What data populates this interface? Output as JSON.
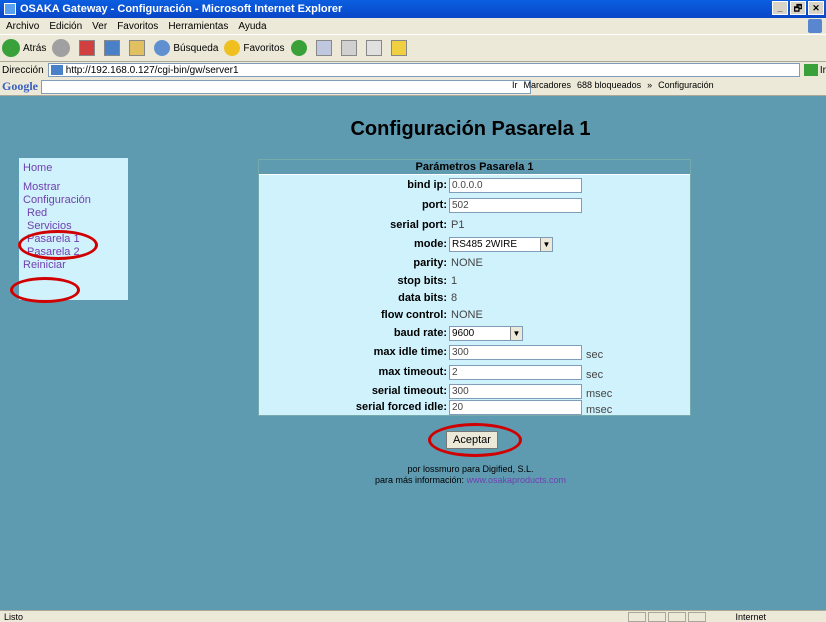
{
  "window": {
    "title": "OSAKA Gateway - Configuración - Microsoft Internet Explorer",
    "buttons": [
      "_",
      "🗗",
      "✕"
    ]
  },
  "menubar": [
    "Archivo",
    "Edición",
    "Ver",
    "Favoritos",
    "Herramientas",
    "Ayuda"
  ],
  "toolbar": {
    "back": "Atrás",
    "search": "Búsqueda",
    "favorites": "Favoritos"
  },
  "address": {
    "label": "Dirección",
    "url": "http://192.168.0.127/cgi-bin/gw/server1",
    "go": "Ir"
  },
  "googlebar": {
    "logo": "Google",
    "go": "Ir",
    "bookmarks": "Marcadores",
    "blocked": "688 bloqueados",
    "more": "»",
    "settings": "Configuración"
  },
  "page": {
    "title": "Configuración Pasarela 1",
    "nav": {
      "home": "Home",
      "show_config": "Mostrar Configuración",
      "red": "Red",
      "services": "Servicios",
      "gateway1": "Pasarela 1",
      "gateway2": "Pasarela 2",
      "restart": "Reiniciar"
    },
    "form": {
      "header": "Parámetros Pasarela 1",
      "bind_ip": {
        "label": "bind ip:",
        "value": "0.0.0.0"
      },
      "port": {
        "label": "port:",
        "value": "502"
      },
      "serial_port": {
        "label": "serial port:",
        "value": "P1"
      },
      "mode": {
        "label": "mode:",
        "value": "RS485 2WIRE"
      },
      "parity": {
        "label": "parity:",
        "value": "NONE"
      },
      "stop_bits": {
        "label": "stop bits:",
        "value": "1"
      },
      "data_bits": {
        "label": "data bits:",
        "value": "8"
      },
      "flow_control": {
        "label": "flow control:",
        "value": "NONE"
      },
      "baud_rate": {
        "label": "baud rate:",
        "value": "9600"
      },
      "max_idle_time": {
        "label": "max idle time:",
        "value": "300",
        "unit": "sec"
      },
      "max_timeout": {
        "label": "max timeout:",
        "value": "2",
        "unit": "sec"
      },
      "serial_timeout": {
        "label": "serial timeout:",
        "value": "300",
        "unit": "msec"
      },
      "serial_forced_idle": {
        "label": "serial forced idle:",
        "value": "20",
        "unit": "msec"
      }
    },
    "accept": "Aceptar",
    "footer": {
      "line1": "por lossmuro para Digified, S.L.",
      "line2_prefix": "para más información:",
      "link": "www.osakaproducts.com"
    }
  },
  "status": {
    "text": "Listo",
    "zone": "Internet"
  },
  "colors": {
    "page_bg": "#5e9ab0",
    "panel_bg": "#cff2fc",
    "link": "#7040b0",
    "annotation": "#d00000"
  }
}
